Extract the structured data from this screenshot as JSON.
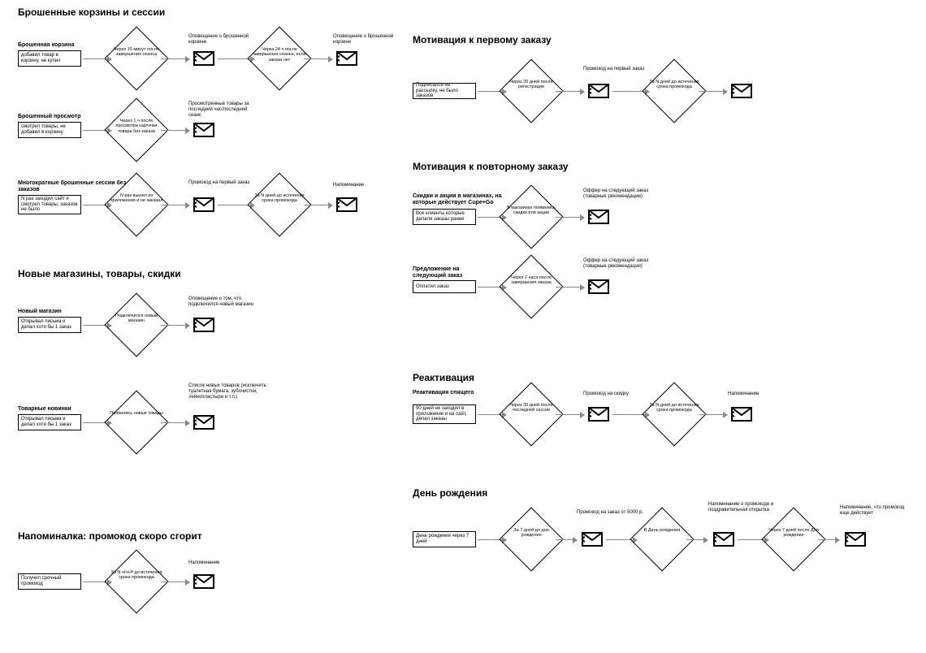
{
  "sections": {
    "abandoned": "Брошенные корзины и сессии",
    "newstores": "Новые магазины, товары, скидки",
    "reminder": "Напоминалка: промокод скоро сгорит",
    "firstorder": "Мотивация к первому заказу",
    "repeat": "Мотивация к повторному заказу",
    "reactivation": "Реактивация",
    "birthday": "День рождения"
  },
  "flows": {
    "f1": {
      "title": "Брошенная корзина",
      "rect": "добавил товар в корзину, не купил",
      "d1": "Через 15 минут после завершения сеанса",
      "cap1": "Оповещение о брошенной корзине",
      "d2": "Через 24 ч после завершения сеанса, если заказа нет",
      "cap2": "Оповещение о брошенной корзине"
    },
    "f2": {
      "title": "Брошенный просмотр",
      "rect": "смотрел товары, не добавил в корзину",
      "d1": "Через 1 ч после просмотра карточки товара без заказа",
      "cap1": "Просмотренные товары за последний час/последний сеанс"
    },
    "f3": {
      "title": "Многократные брошенные сессии без заказов",
      "rect": "N раз заходил сайт и смотрел товары, заказов не было",
      "d1": "N раз вышел из приложения и не заказал",
      "cap1": "Промокод на первый заказ",
      "d2": "За N дней до истечения срока промокода",
      "cap2": "Напоминание"
    },
    "f4": {
      "title": "Новый магазин",
      "rect": "Открывал письма и делал хотя бы 1 заказ",
      "d1": "Подключился новый магазин",
      "cap1": "Оповещение о том, что подключился новый магазин"
    },
    "f5": {
      "title": "Товарные новинки",
      "rect": "Открывал письма и делал хотя бы 1 заказ",
      "d1": "Появились новые товары",
      "cap1": "Список новых товаров (исключить: туалетная бумага, зубочистки, лейкопластыри и т.п.)"
    },
    "f6": {
      "title": "",
      "rect": "Получил срочный промокод",
      "d1": "За N ч/ч+P до истечения срока промокода",
      "cap1": "Напоминание"
    },
    "f7": {
      "rect": "Подписался на рассылку, не было заказов",
      "d1": "Через 20 дней после регистрации",
      "cap1": "Промокод на первый заказ",
      "d2": "За N дней до истечения срока промокода",
      "cap2": ""
    },
    "f8": {
      "title": "Скидки и акции в магазинах, на которые действует Cupe+Go",
      "rect": "Все клиенты которые делали заказы ранее",
      "d1": "В магазинах появились скидки или акции",
      "cap1": "Оффер на следующий заказ (товарные рекомендации)"
    },
    "f9": {
      "title": "Предложение на следующий заказ",
      "rect": "Оплатил заказ",
      "d1": "Через 2 часа после завершения заказа",
      "cap1": "Оффер на следующий заказ (товарные рекомендации)"
    },
    "f10": {
      "title": "Реактивация спящего",
      "rect": "90 дней не заходил в приложение и на сайт, делал заказы",
      "d1": "Через 30 дней после последней сессии",
      "cap1": "Промокод на скидку",
      "d2": "За N дней до истечения срока промокода",
      "cap2": "Напоминание"
    },
    "f11": {
      "rect": "День рождения через 7 дней",
      "d1": "За 7 дней до дня рождения",
      "cap1": "Промокод на заказ от 5000 р.",
      "d2": "В День рождения",
      "cap2": "Напоминание о промокоде и поздравительная открытка",
      "d3": "Через 7 дней после Дня рождения",
      "cap3": "Напоминание, что промокод еще действует"
    }
  }
}
